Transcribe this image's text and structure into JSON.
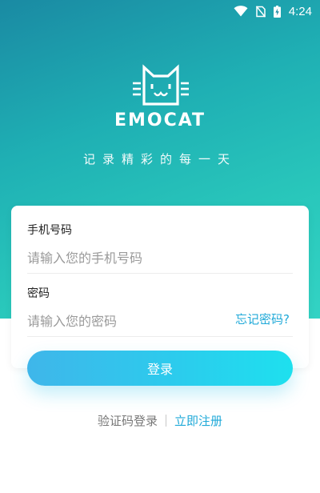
{
  "status_bar": {
    "time": "4:24",
    "icons": [
      "wifi-icon",
      "no-sim-icon",
      "battery-charging-icon"
    ]
  },
  "brand": {
    "name": "EMOCAT",
    "slogan": "记录精彩的每一天",
    "logo_icon": "cat-face-icon"
  },
  "form": {
    "phone_label": "手机号码",
    "phone_placeholder": "请输入您的手机号码",
    "password_label": "密码",
    "password_placeholder": "请输入您的密码",
    "forgot_password": "忘记密码?"
  },
  "actions": {
    "login_label": "登录",
    "sms_login": "验证码登录",
    "register": "立即注册"
  },
  "colors": {
    "hero_start": "#1a8aa3",
    "hero_end": "#33d3c4",
    "accent": "#1fa9d8",
    "button_start": "#3fb6ea",
    "button_end": "#1ee0ee"
  }
}
